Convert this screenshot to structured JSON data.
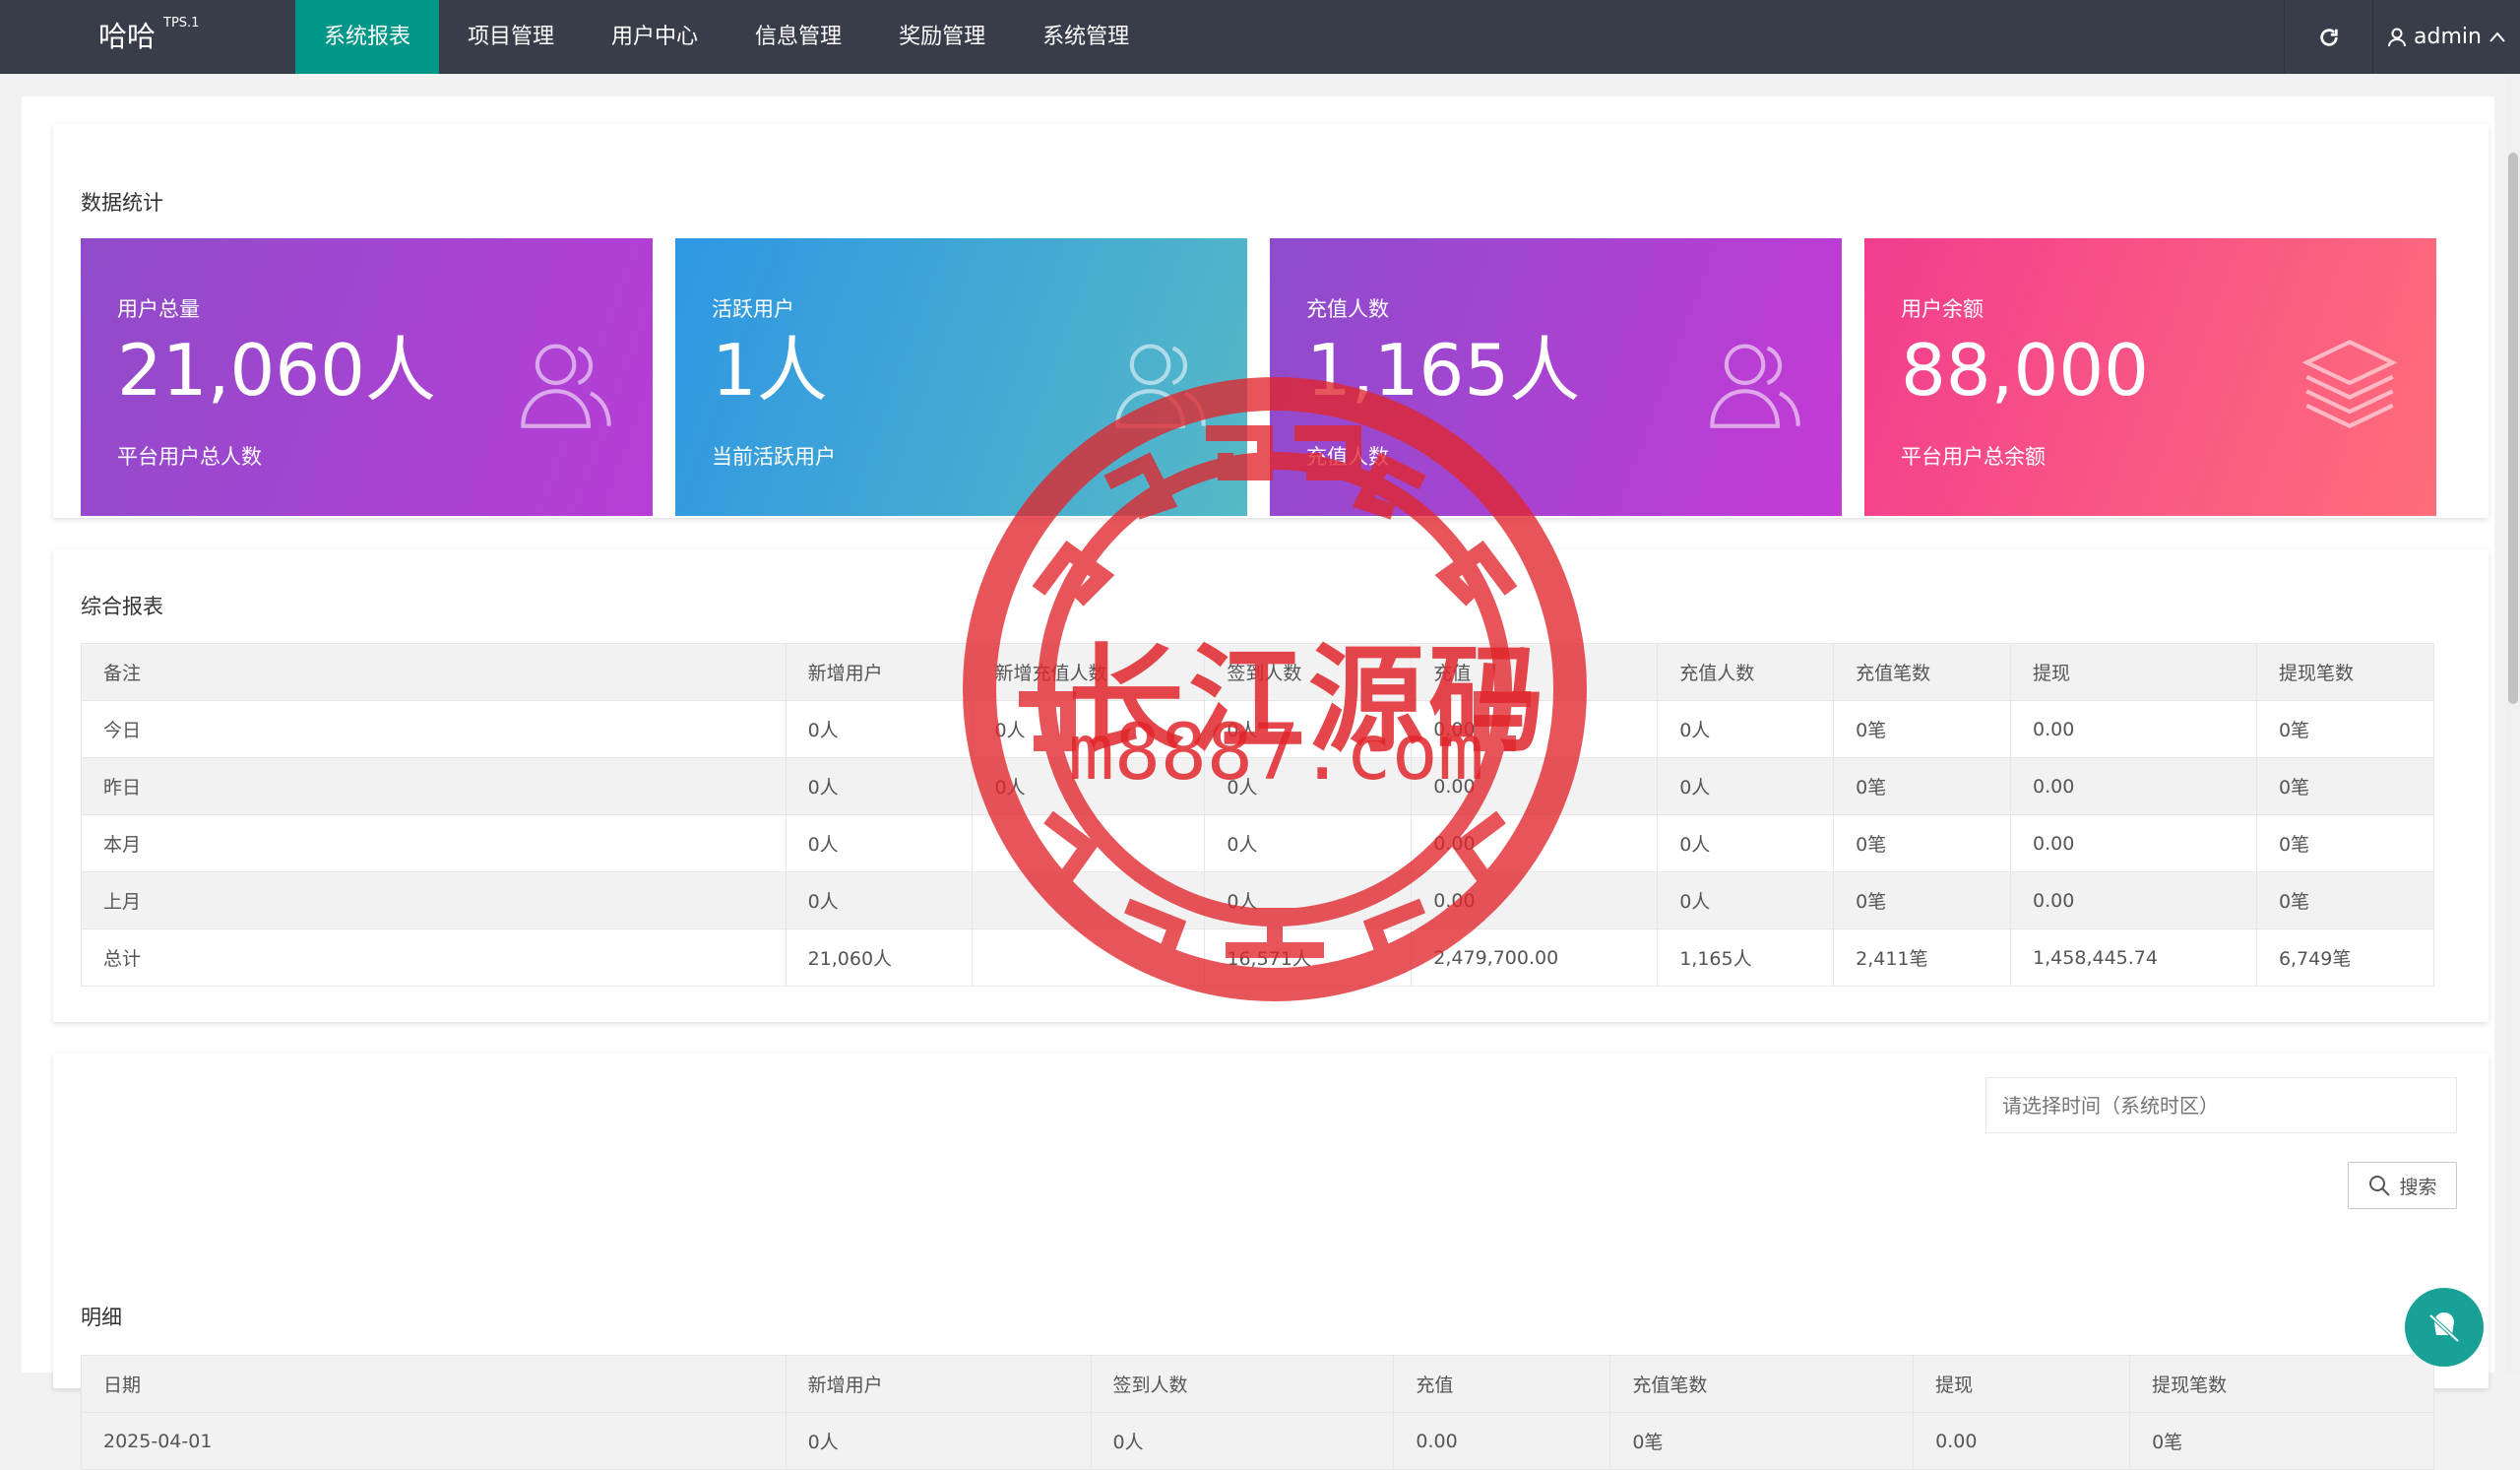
{
  "header": {
    "brand": "哈哈",
    "version": "TPS.1",
    "nav": [
      "系统报表",
      "项目管理",
      "用户中心",
      "信息管理",
      "奖励管理",
      "系统管理"
    ],
    "active_nav": "系统报表",
    "user": "admin"
  },
  "stats_card": {
    "title": "数据统计",
    "items": [
      {
        "label": "用户总量",
        "value": "21,060人",
        "desc": "平台用户总人数",
        "icon": "users-icon"
      },
      {
        "label": "活跃用户",
        "value": "1人",
        "desc": "当前活跃用户",
        "icon": "users-icon"
      },
      {
        "label": "充值人数",
        "value": "1,165人",
        "desc": "充值人数",
        "icon": "users-icon"
      },
      {
        "label": "用户余额",
        "value": "88,000",
        "desc": "平台用户总余额",
        "icon": "layers-icon"
      }
    ]
  },
  "report_card": {
    "title": "综合报表",
    "headers": [
      "备注",
      "新增用户",
      "新增充值人数",
      "签到人数",
      "充值",
      "充值人数",
      "充值笔数",
      "提现",
      "提现笔数"
    ],
    "rows": [
      [
        "今日",
        "0人",
        "0人",
        "0人",
        "0.00",
        "0人",
        "0笔",
        "0.00",
        "0笔"
      ],
      [
        "昨日",
        "0人",
        "0人",
        "0人",
        "0.00",
        "0人",
        "0笔",
        "0.00",
        "0笔"
      ],
      [
        "本月",
        "0人",
        "",
        "0人",
        "0.00",
        "0人",
        "0笔",
        "0.00",
        "0笔"
      ],
      [
        "上月",
        "0人",
        "",
        "0人",
        "0.00",
        "0人",
        "0笔",
        "0.00",
        "0笔"
      ],
      [
        "总计",
        "21,060人",
        "",
        "16,571人",
        "2,479,700.00",
        "1,165人",
        "2,411笔",
        "1,458,445.74",
        "6,749笔"
      ]
    ]
  },
  "detail_card": {
    "title": "明细",
    "date_placeholder": "请选择时间（系统时区）",
    "search_label": "搜索",
    "headers": [
      "日期",
      "新增用户",
      "签到人数",
      "充值",
      "充值笔数",
      "提现",
      "提现笔数"
    ],
    "rows": [
      [
        "2025-04-01",
        "0人",
        "0人",
        "0.00",
        "0笔",
        "0.00",
        "0笔"
      ]
    ]
  },
  "watermark": {
    "line1": "长江源码",
    "line2": "m8887.com"
  },
  "colors": {
    "topbar": "#393d49",
    "active_nav": "#009688",
    "stamp": "#e1262c",
    "float_button": "#18a196"
  }
}
